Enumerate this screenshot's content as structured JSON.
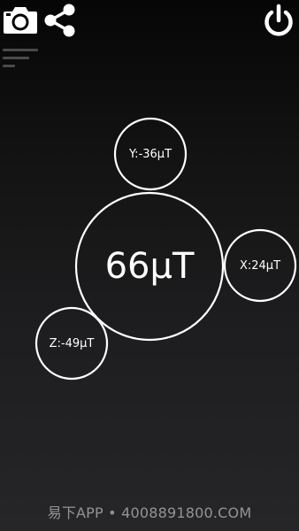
{
  "toolbar": {
    "camera_icon": "camera-icon",
    "share_icon": "share-icon",
    "power_icon": "power-icon",
    "menu_icon": "menu-lines-icon"
  },
  "readings": {
    "total": "66μT",
    "y": "Y:-36μT",
    "x": "X:24μT",
    "z": "Z:-49μT"
  },
  "watermark": {
    "text": "易下APP • 4008891800.COM"
  },
  "colors": {
    "background_top": "#060606",
    "background_bottom": "#262629",
    "ring": "#ffffff",
    "text": "#ffffff",
    "menu_lines": "#4a4a4a"
  }
}
